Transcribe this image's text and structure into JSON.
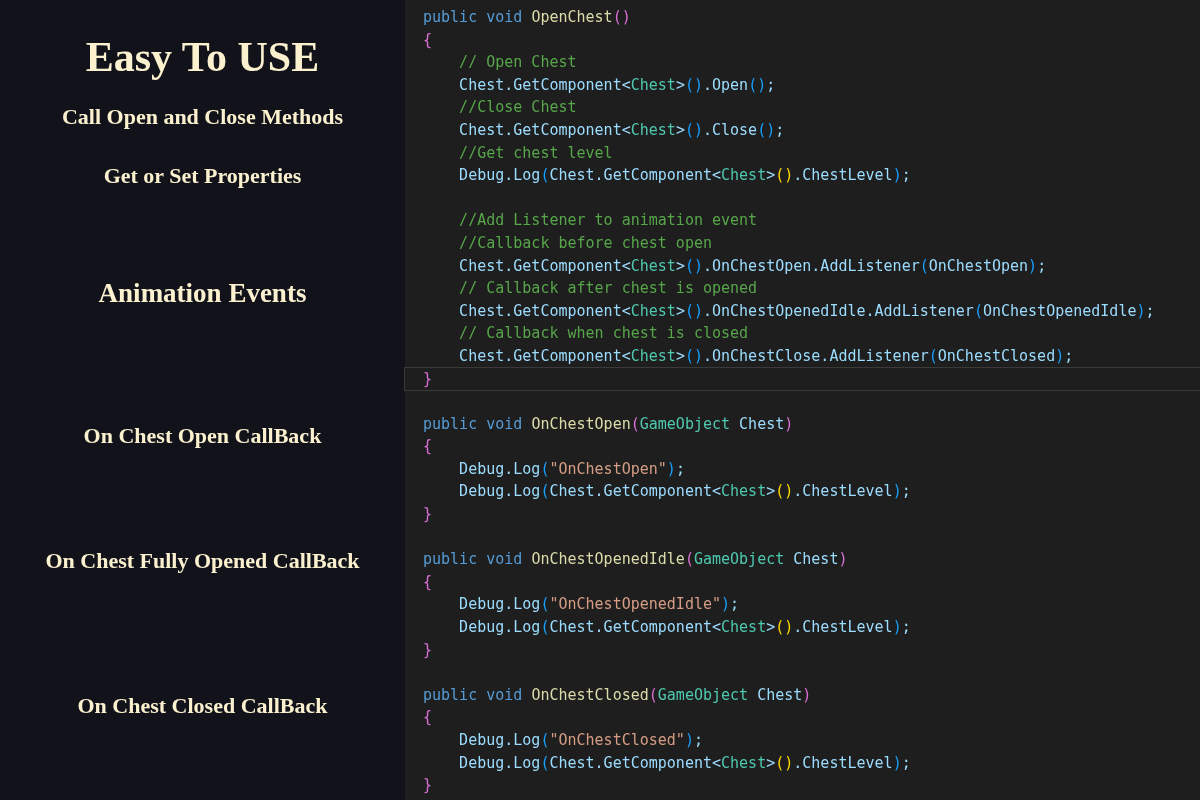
{
  "sidebar": {
    "title": "Easy To USE",
    "items": [
      "Call Open and Close Methods",
      "Get or Set Properties",
      "Animation Events",
      "On Chest Open CallBack",
      "On Chest Fully Opened CallBack",
      "On Chest Closed CallBack"
    ]
  },
  "editor": {
    "lines": [
      {
        "tokens": [
          {
            "kind": "kw",
            "text": "public void "
          },
          {
            "kind": "fn",
            "text": "OpenChest"
          },
          {
            "kind": "p1",
            "text": "()"
          }
        ]
      },
      {
        "tokens": [
          {
            "kind": "p1",
            "text": "{"
          }
        ]
      },
      {
        "tokens": [
          {
            "kind": "cm",
            "text": "    // Open Chest"
          }
        ]
      },
      {
        "tokens": [
          {
            "kind": "id",
            "text": "    Chest.GetComponent<"
          },
          {
            "kind": "type",
            "text": "Chest"
          },
          {
            "kind": "id",
            "text": ">"
          },
          {
            "kind": "p2",
            "text": "()"
          },
          {
            "kind": "id",
            "text": ".Open"
          },
          {
            "kind": "p2",
            "text": "()"
          },
          {
            "kind": "id",
            "text": ";"
          }
        ]
      },
      {
        "tokens": [
          {
            "kind": "cm",
            "text": "    //Close Chest"
          }
        ]
      },
      {
        "tokens": [
          {
            "kind": "id",
            "text": "    Chest.GetComponent<"
          },
          {
            "kind": "type",
            "text": "Chest"
          },
          {
            "kind": "id",
            "text": ">"
          },
          {
            "kind": "p2",
            "text": "()"
          },
          {
            "kind": "id",
            "text": ".Close"
          },
          {
            "kind": "p2",
            "text": "()"
          },
          {
            "kind": "id",
            "text": ";"
          }
        ]
      },
      {
        "tokens": [
          {
            "kind": "cm",
            "text": "    //Get chest level"
          }
        ]
      },
      {
        "tokens": [
          {
            "kind": "id",
            "text": "    Debug.Log"
          },
          {
            "kind": "p2",
            "text": "("
          },
          {
            "kind": "id",
            "text": "Chest.GetComponent<"
          },
          {
            "kind": "type",
            "text": "Chest"
          },
          {
            "kind": "id",
            "text": ">"
          },
          {
            "kind": "p3",
            "text": "()"
          },
          {
            "kind": "id",
            "text": ".ChestLevel"
          },
          {
            "kind": "p2",
            "text": ")"
          },
          {
            "kind": "id",
            "text": ";"
          }
        ]
      },
      {
        "spaced": true,
        "tokens": [
          {
            "kind": "cm",
            "text": "    //Add Listener to animation event"
          }
        ]
      },
      {
        "tokens": [
          {
            "kind": "cm",
            "text": "    //Callback before chest open"
          }
        ]
      },
      {
        "tokens": [
          {
            "kind": "id",
            "text": "    Chest.GetComponent<"
          },
          {
            "kind": "type",
            "text": "Chest"
          },
          {
            "kind": "id",
            "text": ">"
          },
          {
            "kind": "p2",
            "text": "()"
          },
          {
            "kind": "id",
            "text": ".OnChestOpen.AddListener"
          },
          {
            "kind": "p2",
            "text": "("
          },
          {
            "kind": "id",
            "text": "OnChestOpen"
          },
          {
            "kind": "p2",
            "text": ")"
          },
          {
            "kind": "id",
            "text": ";"
          }
        ]
      },
      {
        "tokens": [
          {
            "kind": "cm",
            "text": "    // Callback after chest is opened"
          }
        ]
      },
      {
        "tokens": [
          {
            "kind": "id",
            "text": "    Chest.GetComponent<"
          },
          {
            "kind": "type",
            "text": "Chest"
          },
          {
            "kind": "id",
            "text": ">"
          },
          {
            "kind": "p2",
            "text": "()"
          },
          {
            "kind": "id",
            "text": ".OnChestOpenedIdle.AddListener"
          },
          {
            "kind": "p2",
            "text": "("
          },
          {
            "kind": "id",
            "text": "OnChestOpenedIdle"
          },
          {
            "kind": "p2",
            "text": ")"
          },
          {
            "kind": "id",
            "text": ";"
          }
        ]
      },
      {
        "tokens": [
          {
            "kind": "cm",
            "text": "    // Callback when chest is closed"
          }
        ]
      },
      {
        "tokens": [
          {
            "kind": "id",
            "text": "    Chest.GetComponent<"
          },
          {
            "kind": "type",
            "text": "Chest"
          },
          {
            "kind": "id",
            "text": ">"
          },
          {
            "kind": "p2",
            "text": "()"
          },
          {
            "kind": "id",
            "text": ".OnChestClose.AddListener"
          },
          {
            "kind": "p2",
            "text": "("
          },
          {
            "kind": "id",
            "text": "OnChestClosed"
          },
          {
            "kind": "p2",
            "text": ")"
          },
          {
            "kind": "id",
            "text": ";"
          }
        ]
      },
      {
        "current": true,
        "tokens": [
          {
            "kind": "p1",
            "text": "}"
          }
        ]
      },
      {
        "spaced": true,
        "tokens": [
          {
            "kind": "kw",
            "text": "public void "
          },
          {
            "kind": "fn",
            "text": "OnChestOpen"
          },
          {
            "kind": "p1",
            "text": "("
          },
          {
            "kind": "type",
            "text": "GameObject"
          },
          {
            "kind": "id",
            "text": " Chest"
          },
          {
            "kind": "p1",
            "text": ")"
          }
        ]
      },
      {
        "tokens": [
          {
            "kind": "p1",
            "text": "{"
          }
        ]
      },
      {
        "tokens": [
          {
            "kind": "id",
            "text": "    Debug.Log"
          },
          {
            "kind": "p2",
            "text": "("
          },
          {
            "kind": "str",
            "text": "\"OnChestOpen\""
          },
          {
            "kind": "p2",
            "text": ")"
          },
          {
            "kind": "id",
            "text": ";"
          }
        ]
      },
      {
        "tokens": [
          {
            "kind": "id",
            "text": "    Debug.Log"
          },
          {
            "kind": "p2",
            "text": "("
          },
          {
            "kind": "id",
            "text": "Chest.GetComponent<"
          },
          {
            "kind": "type",
            "text": "Chest"
          },
          {
            "kind": "id",
            "text": ">"
          },
          {
            "kind": "p3",
            "text": "()"
          },
          {
            "kind": "id",
            "text": ".ChestLevel"
          },
          {
            "kind": "p2",
            "text": ")"
          },
          {
            "kind": "id",
            "text": ";"
          }
        ]
      },
      {
        "tokens": [
          {
            "kind": "p1",
            "text": "}"
          }
        ]
      },
      {
        "spaced": true,
        "tokens": [
          {
            "kind": "kw",
            "text": "public void "
          },
          {
            "kind": "fn",
            "text": "OnChestOpenedIdle"
          },
          {
            "kind": "p1",
            "text": "("
          },
          {
            "kind": "type",
            "text": "GameObject"
          },
          {
            "kind": "id",
            "text": " Chest"
          },
          {
            "kind": "p1",
            "text": ")"
          }
        ]
      },
      {
        "tokens": [
          {
            "kind": "p1",
            "text": "{"
          }
        ]
      },
      {
        "tokens": [
          {
            "kind": "id",
            "text": "    Debug.Log"
          },
          {
            "kind": "p2",
            "text": "("
          },
          {
            "kind": "str",
            "text": "\"OnChestOpenedIdle\""
          },
          {
            "kind": "p2",
            "text": ")"
          },
          {
            "kind": "id",
            "text": ";"
          }
        ]
      },
      {
        "tokens": [
          {
            "kind": "id",
            "text": "    Debug.Log"
          },
          {
            "kind": "p2",
            "text": "("
          },
          {
            "kind": "id",
            "text": "Chest.GetComponent<"
          },
          {
            "kind": "type",
            "text": "Chest"
          },
          {
            "kind": "id",
            "text": ">"
          },
          {
            "kind": "p3",
            "text": "()"
          },
          {
            "kind": "id",
            "text": ".ChestLevel"
          },
          {
            "kind": "p2",
            "text": ")"
          },
          {
            "kind": "id",
            "text": ";"
          }
        ]
      },
      {
        "tokens": [
          {
            "kind": "p1",
            "text": "}"
          }
        ]
      },
      {
        "spaced": true,
        "tokens": [
          {
            "kind": "kw",
            "text": "public void "
          },
          {
            "kind": "fn",
            "text": "OnChestClosed"
          },
          {
            "kind": "p1",
            "text": "("
          },
          {
            "kind": "type",
            "text": "GameObject"
          },
          {
            "kind": "id",
            "text": " Chest"
          },
          {
            "kind": "p1",
            "text": ")"
          }
        ]
      },
      {
        "tokens": [
          {
            "kind": "p1",
            "text": "{"
          }
        ]
      },
      {
        "tokens": [
          {
            "kind": "id",
            "text": "    Debug.Log"
          },
          {
            "kind": "p2",
            "text": "("
          },
          {
            "kind": "str",
            "text": "\"OnChestClosed\""
          },
          {
            "kind": "p2",
            "text": ")"
          },
          {
            "kind": "id",
            "text": ";"
          }
        ]
      },
      {
        "tokens": [
          {
            "kind": "id",
            "text": "    Debug.Log"
          },
          {
            "kind": "p2",
            "text": "("
          },
          {
            "kind": "id",
            "text": "Chest.GetComponent<"
          },
          {
            "kind": "type",
            "text": "Chest"
          },
          {
            "kind": "id",
            "text": ">"
          },
          {
            "kind": "p3",
            "text": "()"
          },
          {
            "kind": "id",
            "text": ".ChestLevel"
          },
          {
            "kind": "p2",
            "text": ")"
          },
          {
            "kind": "id",
            "text": ";"
          }
        ]
      },
      {
        "tokens": [
          {
            "kind": "p1",
            "text": "}"
          }
        ]
      }
    ]
  }
}
